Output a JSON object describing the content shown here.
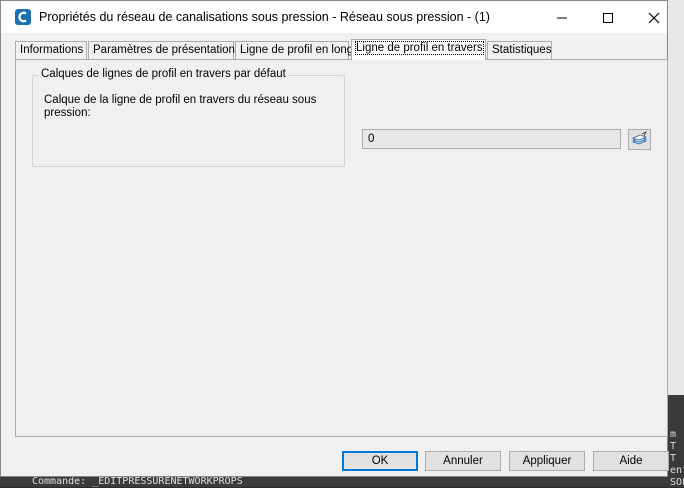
{
  "window": {
    "title": "Propriétés du réseau de canalisations sous pression - Réseau sous pression - (1)",
    "app_icon": "civil3d-c-icon"
  },
  "tabs": [
    {
      "label": "Informations",
      "active": false
    },
    {
      "label": "Paramètres de présentation",
      "active": false
    },
    {
      "label": "Ligne de profil en long",
      "active": false
    },
    {
      "label": "Ligne de profil en travers",
      "active": true
    },
    {
      "label": "Statistiques",
      "active": false
    }
  ],
  "group": {
    "legend": "Calques de lignes de profil en travers par défaut",
    "label": "Calque de la ligne de profil en travers du réseau sous pression:",
    "layer_value": "0",
    "layer_button_icon": "layers-icon"
  },
  "buttons": {
    "ok": "OK",
    "cancel": "Annuler",
    "apply": "Appliquer",
    "help": "Aide"
  },
  "background": {
    "command_line": "Commande:  _EDITPRESSURENETWORKPROPS",
    "side_text": [
      "m",
      "T",
      "T",
      "ent",
      "SOLV"
    ]
  },
  "colors": {
    "accent": "#0078d7",
    "app_icon": "#1f6fb5"
  }
}
